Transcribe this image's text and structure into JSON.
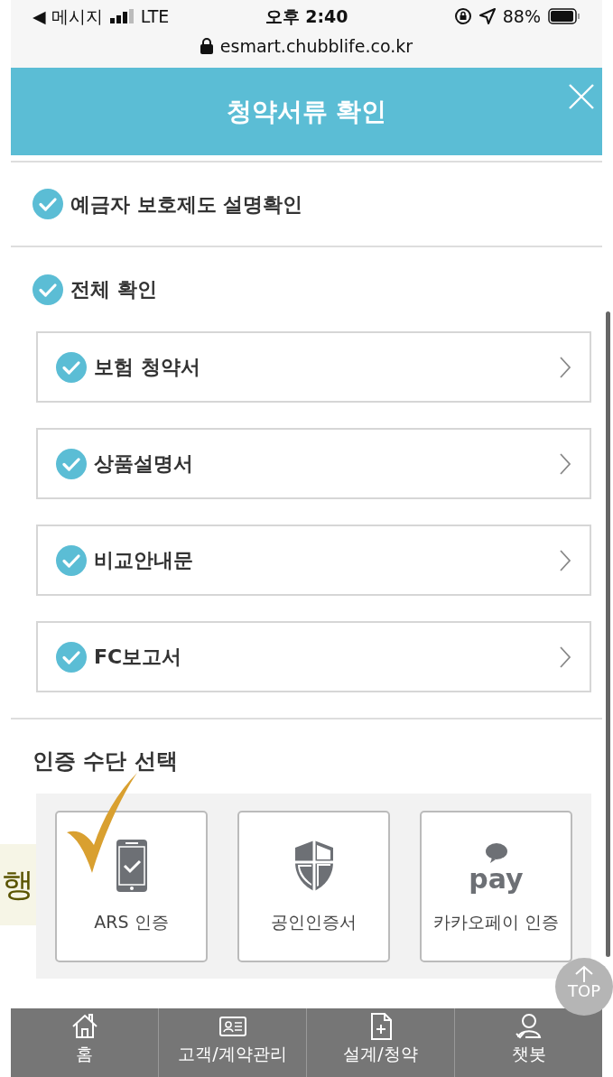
{
  "status_bar": {
    "back": "◀ 메시지",
    "carrier": "LTE",
    "time": "오후 2:40",
    "battery": "88%",
    "url": "esmart.chubblife.co.kr"
  },
  "header": {
    "title": "청약서류 확인"
  },
  "deposit_protection": {
    "label": "예금자 보호제도 설명확인",
    "checked": true
  },
  "all_confirm": {
    "label": "전체 확인",
    "checked": true
  },
  "documents": [
    {
      "label": "보험 청약서",
      "checked": true
    },
    {
      "label": "상품설명서",
      "checked": true
    },
    {
      "label": "비교안내문",
      "checked": true
    },
    {
      "label": "FC보고서",
      "checked": true
    }
  ],
  "auth": {
    "title": "인증 수단 선택",
    "options": [
      {
        "kind": "phone",
        "label": "ARS 인증"
      },
      {
        "kind": "shield",
        "label": "공인인증서"
      },
      {
        "kind": "pay",
        "logo_text": "pay",
        "label": "카카오페이 인증"
      }
    ]
  },
  "side_text": "행",
  "top_button": "TOP",
  "nav": [
    {
      "kind": "home",
      "label": "홈"
    },
    {
      "kind": "card",
      "label": "고객/계약관리"
    },
    {
      "kind": "doc",
      "label": "설계/청약"
    },
    {
      "kind": "person",
      "label": "챗봇"
    }
  ]
}
